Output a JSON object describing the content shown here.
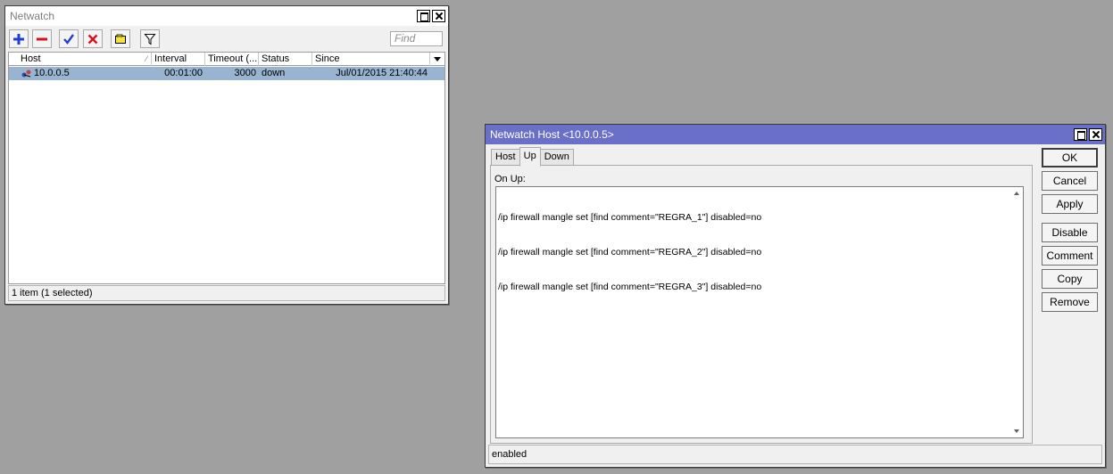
{
  "netwatch": {
    "title": "Netwatch",
    "toolbar": {
      "add_icon": "plus-icon",
      "remove_icon": "minus-icon",
      "enable_icon": "check-icon",
      "disable_icon": "x-icon",
      "comment_icon": "comment-icon",
      "filter_icon": "filter-icon",
      "find_placeholder": "Find"
    },
    "columns": {
      "host": "Host",
      "interval": "Interval",
      "timeout": "Timeout (...",
      "status": "Status",
      "since": "Since"
    },
    "rows": [
      {
        "host": "10.0.0.5",
        "interval": "00:01:00",
        "timeout": "3000",
        "status": "down",
        "since": "Jul/01/2015 21:40:44",
        "selected": true
      }
    ],
    "status_text": "1 item (1 selected)"
  },
  "host_dialog": {
    "title": "Netwatch Host <10.0.0.5>",
    "tabs": [
      "Host",
      "Up",
      "Down"
    ],
    "active_tab": "Up",
    "on_up_label": "On Up:",
    "script_lines": [
      "/ip firewall mangle set [find comment=\"REGRA_1\"] disabled=no",
      "/ip firewall mangle set [find comment=\"REGRA_2\"] disabled=no",
      "/ip firewall mangle set [find comment=\"REGRA_3\"] disabled=no"
    ],
    "buttons": {
      "ok": "OK",
      "cancel": "Cancel",
      "apply": "Apply",
      "disable": "Disable",
      "comment": "Comment",
      "copy": "Copy",
      "remove": "Remove"
    },
    "status_text": "enabled"
  },
  "colors": {
    "desktop": "#a0a0a0",
    "active_titlebar": "#6a70c7",
    "selection": "#99b4d1",
    "add_blue": "#1f3fd6",
    "remove_red": "#d8101e",
    "enable_blue": "#1f3fd6",
    "disable_red": "#d8101e",
    "comment_yellow": "#f6e43c"
  }
}
